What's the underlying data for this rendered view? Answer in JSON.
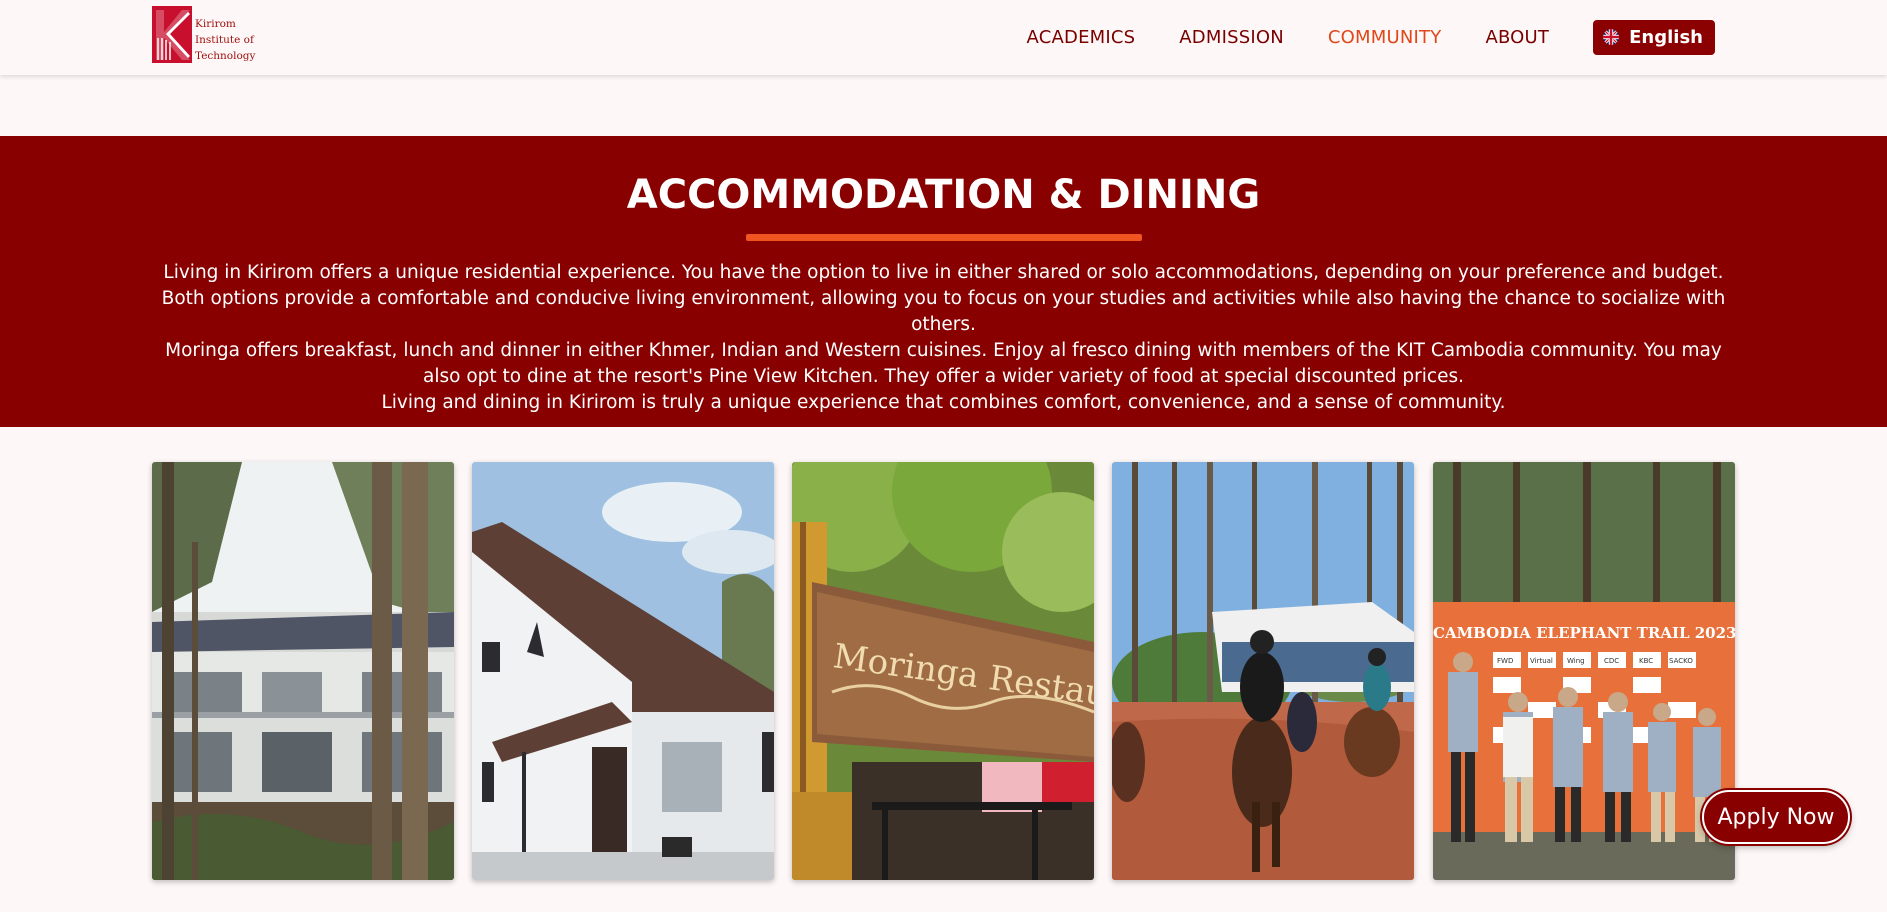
{
  "header": {
    "logo": {
      "line1": "Kirirom",
      "line2": "Institute of",
      "line3": "Technology"
    },
    "nav": [
      {
        "label": "ACADEMICS",
        "active": false
      },
      {
        "label": "ADMISSION",
        "active": false
      },
      {
        "label": "COMMUNITY",
        "active": true
      },
      {
        "label": "ABOUT",
        "active": false
      }
    ],
    "language": {
      "label": "English",
      "icon": "uk-flag-icon"
    }
  },
  "banner": {
    "title": "ACCOMMODATION & DINING",
    "paragraphs": [
      "Living in Kirirom offers a unique residential experience. You have the option to live in either shared or solo accommodations, depending on your preference and budget. Both options provide a comfortable and conducive living environment, allowing you to focus on your studies and activities while also having the chance to socialize with others.",
      "Moringa offers breakfast, lunch and dinner in either Khmer, Indian and Western cuisines. Enjoy al fresco dining with members of the KIT Cambodia community. You may also opt to dine at the resort's Pine View Kitchen. They offer a wider variety of food at special discounted prices.",
      "Living and dining in Kirirom is truly a unique experience that combines comfort, convenience, and a sense of community."
    ]
  },
  "gallery": {
    "photo3_sign": "Moringa Restaurant",
    "photo5_banner": "CAMBODIA ELEPHANT TRAIL 2023",
    "photo5_logos": [
      "FWD",
      "Virtual",
      "Wing",
      "CDC",
      "KBC",
      "SACKO"
    ]
  },
  "apply_button": {
    "label": "Apply Now"
  },
  "colors": {
    "brand": "#880000",
    "accent": "#f05421",
    "nav_text": "#7a0000",
    "nav_active": "#e0471a",
    "background": "#fdf8f7"
  }
}
